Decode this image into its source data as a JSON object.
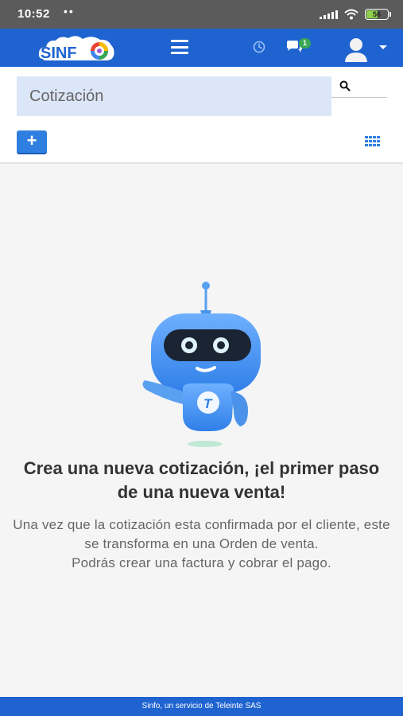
{
  "status_bar": {
    "time": "10:52",
    "dots": "••",
    "battery": "56",
    "battery_level": 0.56
  },
  "header": {
    "logo_text": "SINF",
    "chat_badge": "1",
    "colors": {
      "primary": "#1e63d0",
      "accent": "#3aa757"
    }
  },
  "search": {
    "placeholder": "Cotización"
  },
  "toolbar": {
    "add_label": "+"
  },
  "empty_state": {
    "title": "Crea una nueva cotización, ¡el primer paso de una nueva venta!",
    "line1": "Una vez que la cotización esta confirmada por el cliente, este se transforma en una Orden de venta.",
    "line2": "Podrás crear una factura y cobrar el pago."
  },
  "footer": {
    "text": "Sinfo, un servicio de Teleinte SAS"
  }
}
